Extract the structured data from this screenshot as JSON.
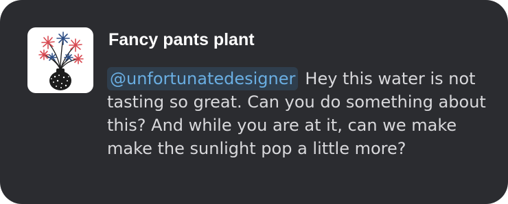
{
  "comment": {
    "author": "Fancy pants plant",
    "avatar_icon": "potted-plant-icon",
    "mention": "@unfortunatedesigner",
    "body": "Hey this water is not tasting so great. Can you do something about this? And while you are at it, can we make make the sunlight pop a little more?"
  },
  "colors": {
    "card_background": "#2b2c30",
    "author_text": "#ffffff",
    "body_text": "#d9d9dc",
    "mention_text": "#6aaee2",
    "mention_background": "#2f3e4d"
  }
}
